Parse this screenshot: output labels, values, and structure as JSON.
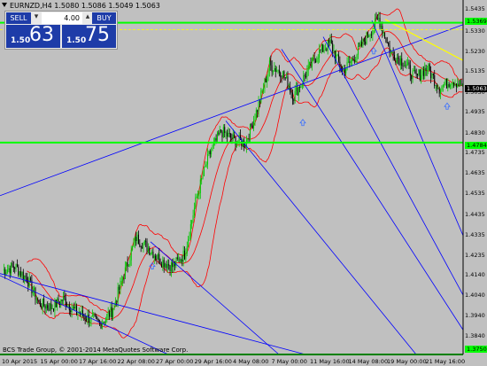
{
  "window": {
    "title": "EURNZD,H4  1.5080 1.5086 1.5049 1.5063"
  },
  "trade_panel": {
    "sell_label": "SELL",
    "buy_label": "BUY",
    "lots_value": "4.00",
    "spin_down": "▾",
    "spin_up": "▴",
    "bid_small": "1.50",
    "bid_big": "63",
    "ask_small": "1.50",
    "ask_big": "75"
  },
  "copyright": "BCS Trade Group, © 2001-2014 MetaQuotes Software Corp.",
  "price_axis": {
    "labels": [
      "1.5435",
      "1.5330",
      "1.5230",
      "1.5135",
      "1.5030",
      "1.4935",
      "1.4830",
      "1.4735",
      "1.4635",
      "1.4535",
      "1.4435",
      "1.4335",
      "1.4235",
      "1.4140",
      "1.4040",
      "1.3940",
      "1.3840"
    ],
    "current_price": "1.5063",
    "upper_line_price": "1.5369",
    "lower_line_price": "1.4784",
    "bottom_line_price": "1.3750"
  },
  "time_axis": {
    "labels": [
      "10 Apr 2015",
      "15 Apr 00:00",
      "17 Apr 16:00",
      "22 Apr 08:00",
      "27 Apr 00:00",
      "29 Apr 16:00",
      "4 May 08:00",
      "7 May 00:00",
      "11 May 16:00",
      "14 May 08:00",
      "19 May 00:00",
      "21 May 16:00"
    ]
  },
  "colors": {
    "background": "#c0c0c0",
    "up_candle": "#00c800",
    "down_candle": "#000000",
    "bollinger": "#ff0000",
    "trendline": "#0000ff",
    "horizontal_line": "#00ff00",
    "channel_line": "#ffff00",
    "panel_blue": "#1e3ca8"
  },
  "chart_data": {
    "type": "candlestick",
    "symbol": "EURNZD",
    "timeframe": "H4",
    "ohlc_last": {
      "open": 1.508,
      "high": 1.5086,
      "low": 1.5049,
      "close": 1.5063
    },
    "ylim": [
      1.375,
      1.548
    ],
    "close_path": [
      [
        0,
        1.416
      ],
      [
        10,
        1.418
      ],
      [
        20,
        1.412
      ],
      [
        30,
        1.4
      ],
      [
        40,
        1.398
      ],
      [
        50,
        1.402
      ],
      [
        60,
        1.396
      ],
      [
        70,
        1.393
      ],
      [
        80,
        1.39
      ],
      [
        90,
        1.396
      ],
      [
        100,
        1.414
      ],
      [
        110,
        1.432
      ],
      [
        120,
        1.427
      ],
      [
        130,
        1.421
      ],
      [
        140,
        1.418
      ],
      [
        150,
        1.424
      ],
      [
        160,
        1.452
      ],
      [
        170,
        1.472
      ],
      [
        180,
        1.484
      ],
      [
        190,
        1.48
      ],
      [
        200,
        1.478
      ],
      [
        210,
        1.495
      ],
      [
        220,
        1.516
      ],
      [
        230,
        1.513
      ],
      [
        240,
        1.501
      ],
      [
        250,
        1.512
      ],
      [
        260,
        1.522
      ],
      [
        270,
        1.527
      ],
      [
        280,
        1.513
      ],
      [
        290,
        1.52
      ],
      [
        300,
        1.53
      ],
      [
        310,
        1.539
      ],
      [
        320,
        1.522
      ],
      [
        330,
        1.518
      ],
      [
        340,
        1.51
      ],
      [
        350,
        1.515
      ],
      [
        360,
        1.505
      ],
      [
        370,
        1.509
      ],
      [
        380,
        1.5063
      ]
    ],
    "horizontal_lines": [
      1.5369,
      1.4784,
      1.375
    ],
    "dashed_line": 1.5335
  }
}
